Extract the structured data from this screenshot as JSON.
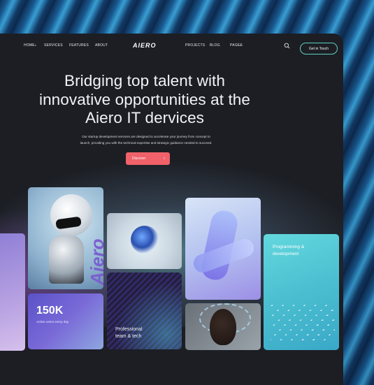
{
  "nav": {
    "home": "HOME",
    "services": "SERVICES",
    "features": "FEATURES",
    "about": "ABOUT",
    "logo": "AIERO",
    "projects": "PROJECTS",
    "blog": "BLOG",
    "pages": "PAGES",
    "cta": "Get in Touch"
  },
  "hero": {
    "title_line1": "Bridging top talent with",
    "title_line2": "innovative opportunities at the",
    "title_line3": "Aiero IT dervices",
    "subtitle_line1": "Our startup development services are designed to accelerate your journey from concept to",
    "subtitle_line2": "launch, providing you with the technical expertise and strategic guidance needed to succeed.",
    "button": "Discover"
  },
  "cards": {
    "robot_brand": "Aiero",
    "stat_value": "150K",
    "stat_label": "Active users every day",
    "team_line1": "Professional",
    "team_line2": "team & tech",
    "prog_line1": "Programming &",
    "prog_line2": "development"
  },
  "icons": {
    "search": "search-icon",
    "arrow": "arrow-right-icon",
    "dropdown": "chevron-down-icon"
  },
  "colors": {
    "accent": "#f0616a",
    "teal": "#5fd0c0",
    "frame": "#1c1e24"
  }
}
